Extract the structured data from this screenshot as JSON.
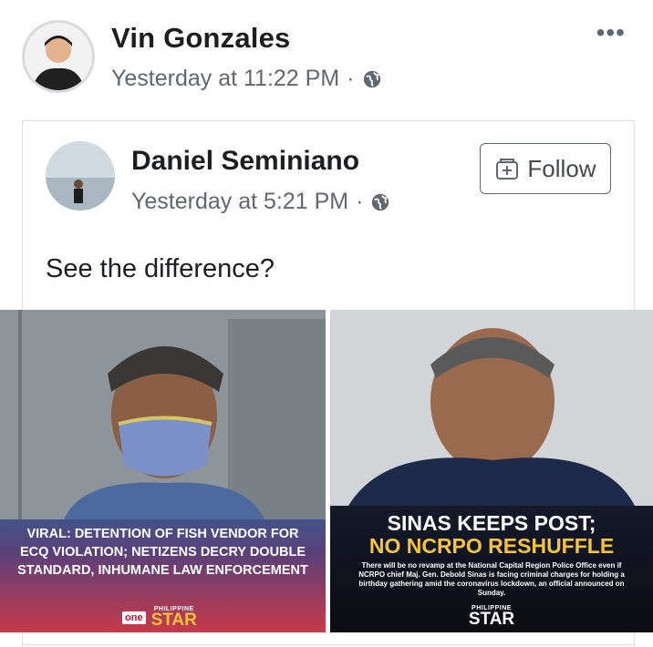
{
  "post": {
    "author": "Vin Gonzales",
    "timestamp": "Yesterday at 11:22 PM",
    "separator": "·",
    "privacy_icon": "globe-icon",
    "more_icon": "more-options-icon",
    "more_label": "•••"
  },
  "shared": {
    "author": "Daniel Seminiano",
    "timestamp": "Yesterday at 5:21 PM",
    "separator": "·",
    "privacy_icon": "globe-icon",
    "follow_label": "Follow",
    "text": "See the difference?"
  },
  "images": {
    "left": {
      "caption": "VIRAL: DETENTION OF FISH VENDOR FOR ECQ VIOLATION; NETIZENS DECRY DOUBLE STANDARD, INHUMANE LAW ENFORCEMENT",
      "brand_one": "one",
      "brand_small": "PHILIPPINE",
      "brand_big": "STAR"
    },
    "right": {
      "title_line1": "SINAS KEEPS POST;",
      "title_line2": "NO NCRPO RESHUFFLE",
      "body": "There will be no revamp at the National Capital Region Police Office even if NCRPO chief Maj. Gen. Debold Sinas is facing criminal charges for holding a birthday gathering amid the coronavirus lockdown, an official announced on Sunday.",
      "brand_small": "PHILIPPINE",
      "brand_big": "STAR"
    }
  },
  "colors": {
    "name": "#1c1e21",
    "meta": "#606770",
    "accent_yellow": "#f6c53a",
    "border": "#dadde1"
  }
}
